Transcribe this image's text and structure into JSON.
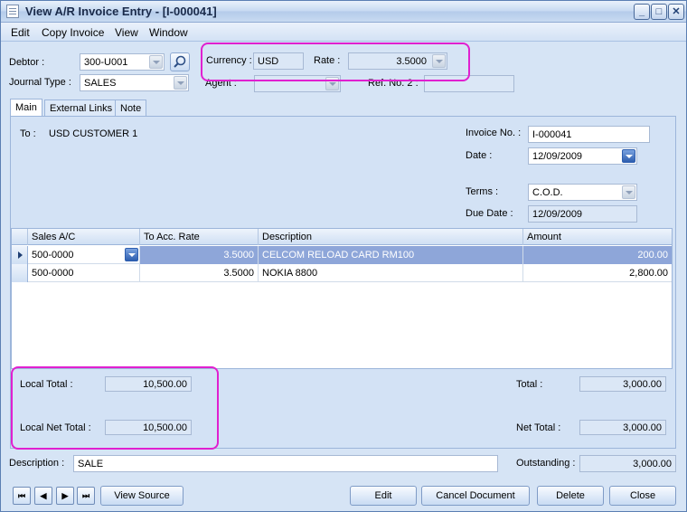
{
  "window": {
    "title": "View A/R Invoice Entry - [I-000041]",
    "minimize": "_",
    "maximize": "□",
    "close": "✕"
  },
  "menu": {
    "items": [
      {
        "label": "Edit"
      },
      {
        "label": "Copy Invoice"
      },
      {
        "label": "View"
      },
      {
        "label": "Window"
      }
    ]
  },
  "header": {
    "debtor_label": "Debtor :",
    "debtor_value": "300-U001",
    "journal_label": "Journal Type :",
    "journal_value": "SALES",
    "currency_label": "Currency :",
    "currency_value": "USD",
    "rate_label": "Rate :",
    "rate_value": "3.5000",
    "agent_label": "Agent :",
    "agent_value": "",
    "ref2_label": "Ref. No. 2 :",
    "ref2_value": ""
  },
  "tabs": [
    {
      "label": "Main"
    },
    {
      "label": "External Links"
    },
    {
      "label": "Note"
    }
  ],
  "main": {
    "to_label": "To :",
    "to_value": "USD CUSTOMER 1",
    "invoice_no_label": "Invoice No. :",
    "invoice_no_value": "I-000041",
    "date_label": "Date :",
    "date_value": "12/09/2009",
    "terms_label": "Terms :",
    "terms_value": "C.O.D.",
    "due_date_label": "Due Date :",
    "due_date_value": "12/09/2009"
  },
  "grid": {
    "columns": [
      "Sales A/C",
      "To Acc. Rate",
      "Description",
      "Amount"
    ],
    "rows": [
      {
        "sales_ac": "500-0000",
        "rate": "3.5000",
        "description": "CELCOM RELOAD CARD RM100",
        "amount": "200.00"
      },
      {
        "sales_ac": "500-0000",
        "rate": "3.5000",
        "description": "NOKIA 8800",
        "amount": "2,800.00"
      }
    ]
  },
  "totals": {
    "local_total_label": "Local Total :",
    "local_total_value": "10,500.00",
    "local_net_total_label": "Local Net Total :",
    "local_net_total_value": "10,500.00",
    "total_label": "Total :",
    "total_value": "3,000.00",
    "net_total_label": "Net Total :",
    "net_total_value": "3,000.00"
  },
  "footer": {
    "description_label": "Description :",
    "description_value": "SALE",
    "outstanding_label": "Outstanding :",
    "outstanding_value": "3,000.00"
  },
  "buttons": {
    "first": "⏮",
    "prev": "◀",
    "next": "▶",
    "last": "⏭",
    "view_source": "View Source",
    "edit": "Edit",
    "cancel_document": "Cancel Document",
    "delete": "Delete",
    "close": "Close"
  },
  "colors": {
    "highlight_annotation": "#e020d0",
    "selected_row": "#8ea6d9"
  }
}
